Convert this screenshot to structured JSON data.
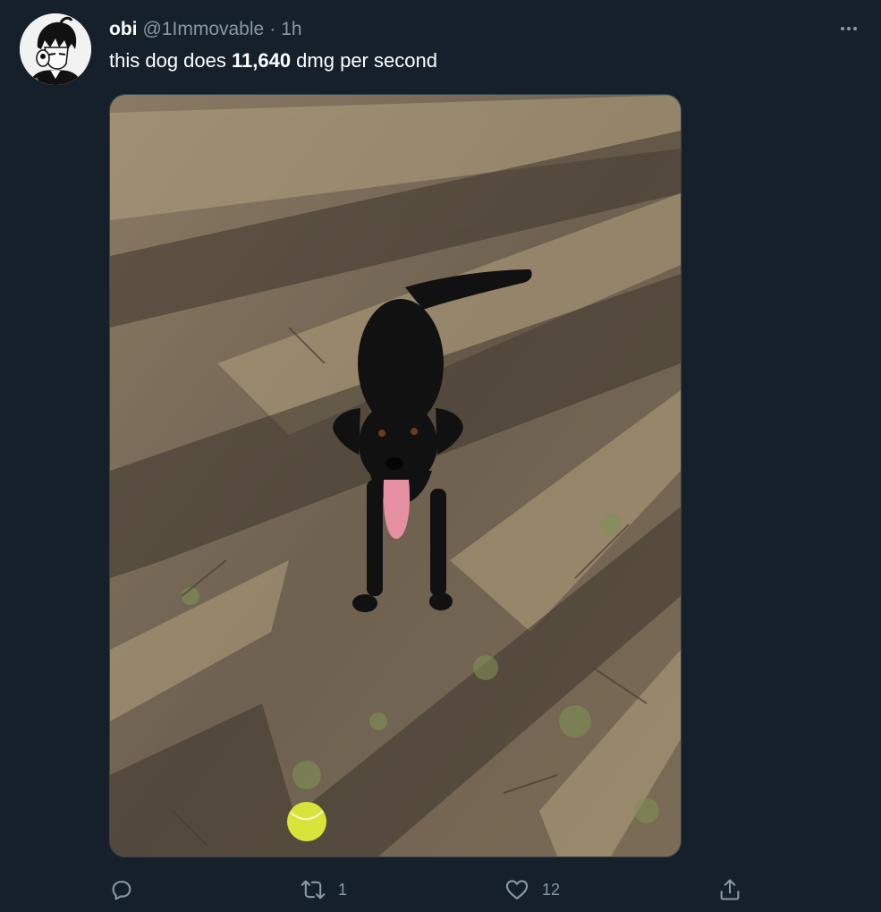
{
  "tweet": {
    "author_name": "obi",
    "handle": "@1Immovable",
    "separator": "·",
    "time": "1h",
    "text_before": "this dog does ",
    "text_bold": "11,640",
    "text_after": " dmg per second"
  },
  "icons": {
    "more": "more-horizontal-icon",
    "reply": "reply-icon",
    "retweet": "retweet-icon",
    "like": "heart-icon",
    "share": "share-icon"
  },
  "actions": {
    "reply_count": "",
    "retweet_count": "1",
    "like_count": "12"
  },
  "colors": {
    "background": "#15202b",
    "secondary_text": "#8b98a5",
    "border": "#38444d"
  }
}
